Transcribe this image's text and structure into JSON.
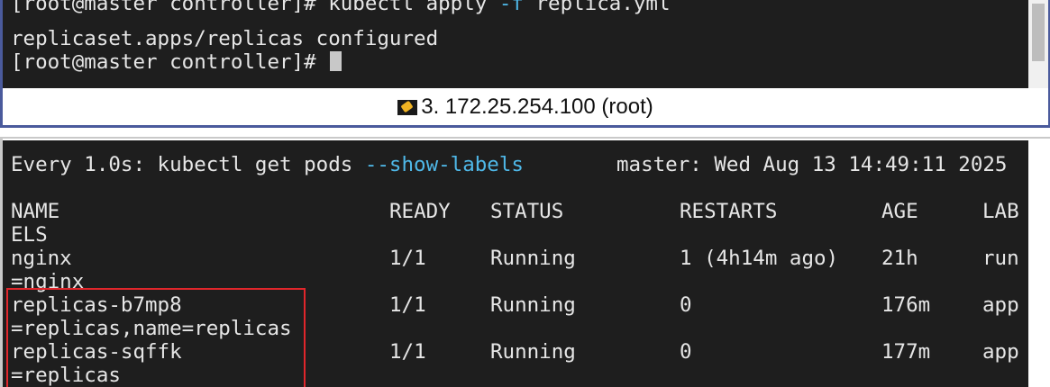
{
  "top_terminal": {
    "line1_prompt": "[root@master controller]# ",
    "line1_cmd": "kubectl apply ",
    "line1_flag": "-f",
    "line1_arg": " replica.yml",
    "line2": "replicaset.apps/replicas configured",
    "line3_prompt": "[root@master controller]# "
  },
  "tab": {
    "icon": "pen-icon",
    "title": "3. 172.25.254.100 (root)"
  },
  "bottom_terminal": {
    "watch_prefix": "Every 1.0s: kubectl get pods ",
    "watch_flag": "--show-labels",
    "watch_status": "master: Wed Aug 13 14:49:11 2025",
    "columns": {
      "name": "NAME",
      "ready": "READY",
      "status": "STATUS",
      "restarts": "RESTARTS",
      "age": "AGE",
      "labels_head": "LAB",
      "labels_tail": "ELS"
    },
    "pods": [
      {
        "name": "nginx",
        "ready": "1/1",
        "status": "Running",
        "restarts": "1 (4h14m ago)",
        "age": "21h",
        "labels_head": "run",
        "labels_tail": "=nginx"
      },
      {
        "name": "replicas-b7mp8",
        "ready": "1/1",
        "status": "Running",
        "restarts": "0",
        "age": "176m",
        "labels_head": "app",
        "labels_tail": "=replicas,name=replicas"
      },
      {
        "name": "replicas-sqffk",
        "ready": "1/1",
        "status": "Running",
        "restarts": "0",
        "age": "177m",
        "labels_head": "app",
        "labels_tail": "=replicas"
      }
    ]
  },
  "colors": {
    "terminal_bg": "#1e1e1e",
    "terminal_fg": "#e6e6e6",
    "flag_color": "#4fb8e8",
    "highlight_border": "#e0262b",
    "pane_border": "#4a5a9c"
  }
}
